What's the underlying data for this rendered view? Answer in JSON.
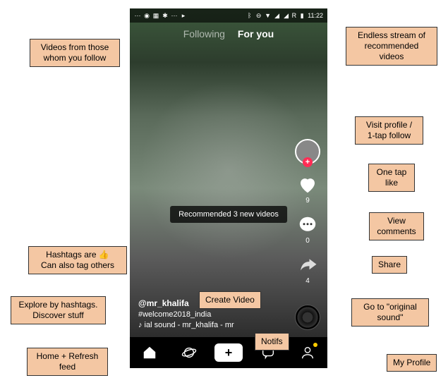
{
  "status": {
    "time": "11:22",
    "carrier": "R"
  },
  "tabs": {
    "following": "Following",
    "foryou": "For you"
  },
  "toast": "Recommended 3 new videos",
  "rail": {
    "likes": "9",
    "comments": "0",
    "shares": "4"
  },
  "caption": {
    "username": "@mr_khalifa",
    "hashtag": "#welcome2018_india",
    "sound": "♪  ial sound - mr_khalifa - mr"
  },
  "callouts": {
    "follow_feed": "Videos from those\nwhom you follow",
    "foryou_feed": "Endless stream of\nrecommended videos",
    "profile_follow": "Visit profile /\n1-tap follow",
    "like": "One tap\nlike",
    "comments": "View\ncomments",
    "share": "Share",
    "hashtags": "Hashtags are 👍\nCan also tag others",
    "explore": "Explore by hashtags.\nDiscover stuff",
    "home": "Home + Refresh\nfeed",
    "create": "Create Video",
    "notifs": "Notifs",
    "sound": "Go to \"original\nsound\"",
    "me": "My Profile"
  }
}
